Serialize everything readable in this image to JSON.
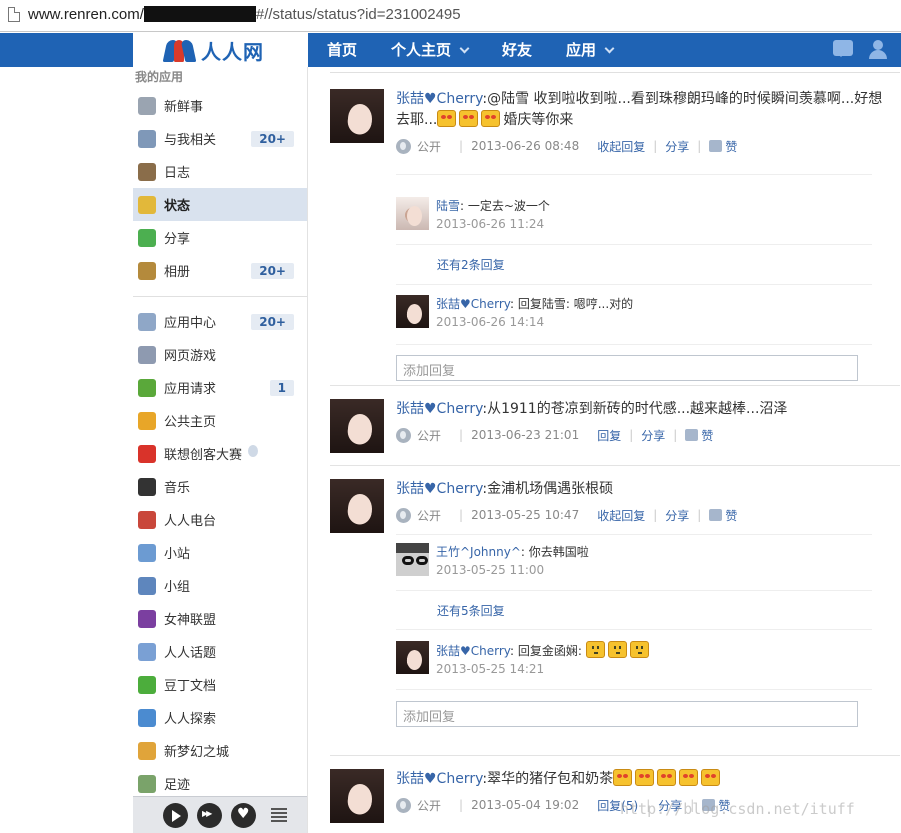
{
  "address_bar": {
    "url_prefix": "www.renren.com/",
    "url_suffix": "#//status/status?id=231002495"
  },
  "nav": {
    "logo_text": "人人网",
    "items": [
      {
        "label": "首页",
        "dropdown": false
      },
      {
        "label": "个人主页",
        "dropdown": true
      },
      {
        "label": "好友",
        "dropdown": false
      },
      {
        "label": "应用",
        "dropdown": true
      }
    ],
    "colors": {
      "bar": "#1f63b4"
    }
  },
  "sidebar": {
    "title": "我的应用",
    "items": [
      {
        "label": "新鲜事",
        "icon": "feed-icon",
        "color": "#9aa4b1",
        "badge": ""
      },
      {
        "label": "与我相关",
        "icon": "related-icon",
        "color": "#7f98b8",
        "badge": "20+"
      },
      {
        "label": "日志",
        "icon": "blog-icon",
        "color": "#8a6d4a",
        "badge": ""
      },
      {
        "label": "状态",
        "icon": "status-icon",
        "color": "#e2b83a",
        "badge": ""
      },
      {
        "label": "分享",
        "icon": "share-icon",
        "color": "#4caf50",
        "badge": ""
      },
      {
        "label": "相册",
        "icon": "album-icon",
        "color": "#b48a3c",
        "badge": "20+"
      },
      {
        "label": "应用中心",
        "icon": "puzzle-icon",
        "color": "#8fa7c7",
        "badge": "20+"
      },
      {
        "label": "网页游戏",
        "icon": "gamepad-icon",
        "color": "#8e9ab0",
        "badge": ""
      },
      {
        "label": "应用请求",
        "icon": "request-icon",
        "color": "#5aa83a",
        "badge": "1"
      },
      {
        "label": "公共主页",
        "icon": "bookmark-icon",
        "color": "#e8a628",
        "badge": ""
      },
      {
        "label": "联想创客大赛",
        "icon": "lenovo-icon",
        "color": "#d9332a",
        "badge": ""
      },
      {
        "label": "音乐",
        "icon": "music-icon",
        "color": "#333333",
        "badge": ""
      },
      {
        "label": "人人电台",
        "icon": "radio-icon",
        "color": "#c9473b",
        "badge": ""
      },
      {
        "label": "小站",
        "icon": "station-icon",
        "color": "#6c9bd2",
        "badge": ""
      },
      {
        "label": "小组",
        "icon": "group-icon",
        "color": "#5e86bd",
        "badge": ""
      },
      {
        "label": "女神联盟",
        "icon": "goddess-icon",
        "color": "#7b3fa0",
        "badge": ""
      },
      {
        "label": "人人话题",
        "icon": "topic-icon",
        "color": "#7aa0d4",
        "badge": ""
      },
      {
        "label": "豆丁文档",
        "icon": "docin-icon",
        "color": "#4cad3c",
        "badge": ""
      },
      {
        "label": "人人探索",
        "icon": "compass-icon",
        "color": "#4b8bd0",
        "badge": ""
      },
      {
        "label": "新梦幻之城",
        "icon": "dreamcity-icon",
        "color": "#e0a43a",
        "badge": ""
      },
      {
        "label": "足迹",
        "icon": "footprint-icon",
        "color": "#7aa36a",
        "badge": ""
      }
    ],
    "active_index": 3
  },
  "feed": {
    "posts": [
      {
        "author": "张喆♥Cherry",
        "text": ":@陆雪 收到啦收到啦...看到珠穆朗玛峰的时候瞬间羡慕啊...好想去耶...",
        "emoticons": [
          "kiss",
          "kiss",
          "kiss"
        ],
        "text_after": "婚庆等你来",
        "visibility": "公开",
        "time": "2013-06-26 08:48",
        "reply_action": "收起回复",
        "share": "分享",
        "like": "赞",
        "replies": [
          {
            "author": "陆雪",
            "text": ": 一定去~波一个",
            "time": "2013-06-26 11:24"
          },
          {
            "author": "张喆♥Cherry",
            "text": ": 回复陆雪: 嗯哼...对的",
            "time": "2013-06-26 14:14"
          }
        ],
        "more_replies": "还有2条回复",
        "reply_placeholder": "添加回复"
      },
      {
        "author": "张喆♥Cherry",
        "text": ":从1911的苍凉到新砖的时代感...越来越棒...沼泽",
        "visibility": "公开",
        "time": "2013-06-23 21:01",
        "reply_action": "回复",
        "share": "分享",
        "like": "赞"
      },
      {
        "author": "张喆♥Cherry",
        "text": ":金浦机场偶遇张根硕",
        "visibility": "公开",
        "time": "2013-05-25 10:47",
        "reply_action": "收起回复",
        "share": "分享",
        "like": "赞",
        "replies": [
          {
            "author": "王竹^Johnny^",
            "text": ": 你去韩国啦",
            "time": "2013-05-25 11:00"
          },
          {
            "author": "张喆♥Cherry",
            "text": ": 回复金函娴: ",
            "emoticons": [
              "face",
              "face",
              "face"
            ],
            "time": "2013-05-25 14:21"
          }
        ],
        "more_replies": "还有5条回复",
        "reply_placeholder": "添加回复"
      },
      {
        "author": "张喆♥Cherry",
        "text": ":翠华的猪仔包和奶茶",
        "emoticons": [
          "kiss",
          "kiss",
          "kiss",
          "kiss",
          "kiss"
        ],
        "visibility": "公开",
        "time": "2013-05-04 19:02",
        "reply_action": "回复(5)",
        "share": "分享",
        "like": "赞"
      }
    ]
  },
  "watermark": "http://blog.csdn.net/ituff",
  "player": {
    "icons": [
      "play-icon",
      "next-icon",
      "heart-icon",
      "playlist-icon"
    ]
  }
}
